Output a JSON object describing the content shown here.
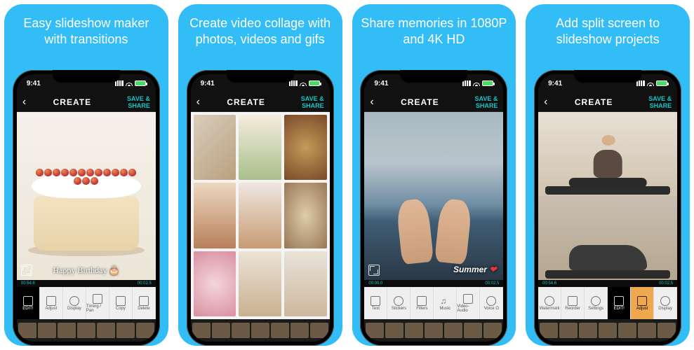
{
  "panels": [
    {
      "headline": "Easy slideshow maker with transitions"
    },
    {
      "headline": "Create video collage with photos, videos and gifs"
    },
    {
      "headline": "Share memories in 1080P and 4K HD"
    },
    {
      "headline": "Add split screen to slideshow projects"
    }
  ],
  "status": {
    "time": "9:41"
  },
  "nav": {
    "title": "CREATE",
    "action": "SAVE & SHARE"
  },
  "overlay": {
    "cake_caption": "Happy Birthday 🎂",
    "summer_caption": "Summer",
    "heart": "❤"
  },
  "time": {
    "left": "00:54.6",
    "right": "00:02.5",
    "left2": "00:00.0"
  },
  "tools_edit": [
    {
      "id": "edit",
      "label": "EDIT!",
      "active": true
    },
    {
      "id": "adjust",
      "label": "Adjust"
    },
    {
      "id": "display",
      "label": "Display"
    },
    {
      "id": "timing",
      "label": "Timing / Pan"
    },
    {
      "id": "copy",
      "label": "Copy"
    },
    {
      "id": "delete",
      "label": "Delete"
    }
  ],
  "tools_share": [
    {
      "id": "text",
      "label": "Text"
    },
    {
      "id": "stickers",
      "label": "Stickers"
    },
    {
      "id": "filters",
      "label": "Filters"
    },
    {
      "id": "music",
      "label": "Music"
    },
    {
      "id": "videoaudio",
      "label": "Video-Audio"
    },
    {
      "id": "voice",
      "label": "Voice O"
    }
  ],
  "tools_split": [
    {
      "id": "watermark",
      "label": "Watermark"
    },
    {
      "id": "reorder",
      "label": "Reorder"
    },
    {
      "id": "settings",
      "label": "Settings"
    },
    {
      "id": "edit",
      "label": "EDIT!",
      "active": true
    },
    {
      "id": "adjust",
      "label": "Adjust",
      "active2": true
    },
    {
      "id": "display",
      "label": "Display"
    }
  ]
}
